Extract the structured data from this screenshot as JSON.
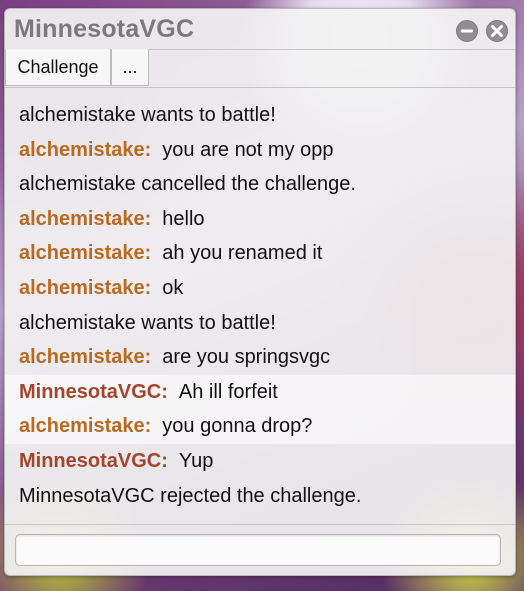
{
  "window": {
    "title": "MinnesotaVGC",
    "controls": [
      "minimize-icon",
      "close-icon"
    ]
  },
  "tabs": {
    "challenge_label": "Challenge",
    "more_label": "..."
  },
  "messages": [
    {
      "type": "system",
      "text": "alchemistake wants to battle!"
    },
    {
      "type": "chat",
      "user": "alchemistake:",
      "text": "you are not my opp"
    },
    {
      "type": "system",
      "text": "alchemistake cancelled the challenge."
    },
    {
      "type": "chat",
      "user": "alchemistake:",
      "text": "hello"
    },
    {
      "type": "chat",
      "user": "alchemistake:",
      "text": "ah you renamed it"
    },
    {
      "type": "chat",
      "user": "alchemistake:",
      "text": "ok"
    },
    {
      "type": "system",
      "text": "alchemistake wants to battle!"
    },
    {
      "type": "chat",
      "user": "alchemistake:",
      "text": "are you springsvgc"
    },
    {
      "type": "chat",
      "user": "MinnesotaVGC:",
      "text": "Ah ill forfeit"
    },
    {
      "type": "chat",
      "user": "alchemistake:",
      "text": "you gonna drop?"
    },
    {
      "type": "chat",
      "user": "MinnesotaVGC:",
      "text": "Yup"
    },
    {
      "type": "system",
      "text": "MinnesotaVGC rejected the challenge."
    }
  ],
  "composer": {
    "value": "",
    "placeholder": ""
  },
  "colors": {
    "user_alchemistake": "#b96a22",
    "user_minnesotavgc": "#a2452c",
    "title_text": "#7a7a7a"
  }
}
